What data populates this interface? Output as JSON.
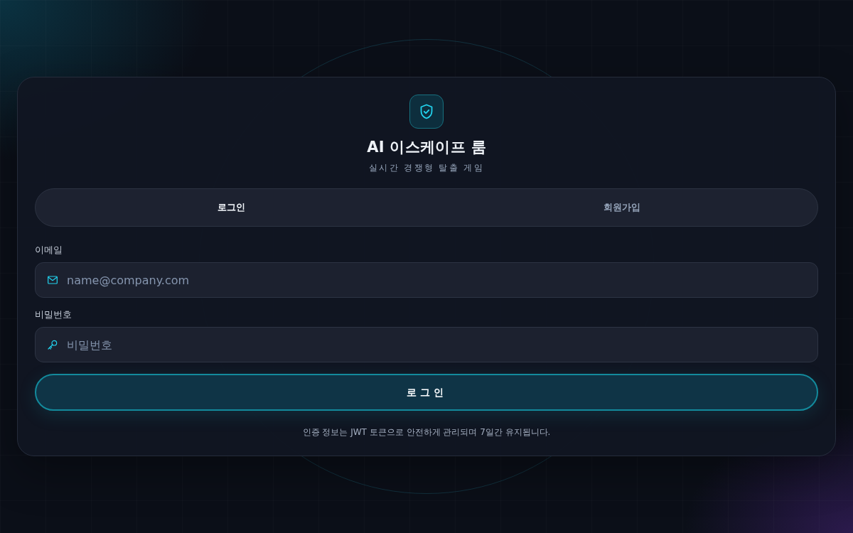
{
  "app": {
    "title": "AI 이스케이프 룸",
    "subtitle": "실시간 경쟁형 탈출 게임"
  },
  "tabs": [
    {
      "label": "로그인",
      "selected": true
    },
    {
      "label": "회원가입",
      "selected": false
    }
  ],
  "fields": [
    {
      "kind": "email",
      "label": "이메일",
      "placeholder": "name@company.com"
    },
    {
      "kind": "password",
      "label": "비밀번호",
      "placeholder": "비밀번호"
    }
  ],
  "submit_button": {
    "label": "로그인"
  },
  "note": "인증 정보는 JWT 토큰으로 안전하게 관리되며 7일간 유지됩니다."
}
